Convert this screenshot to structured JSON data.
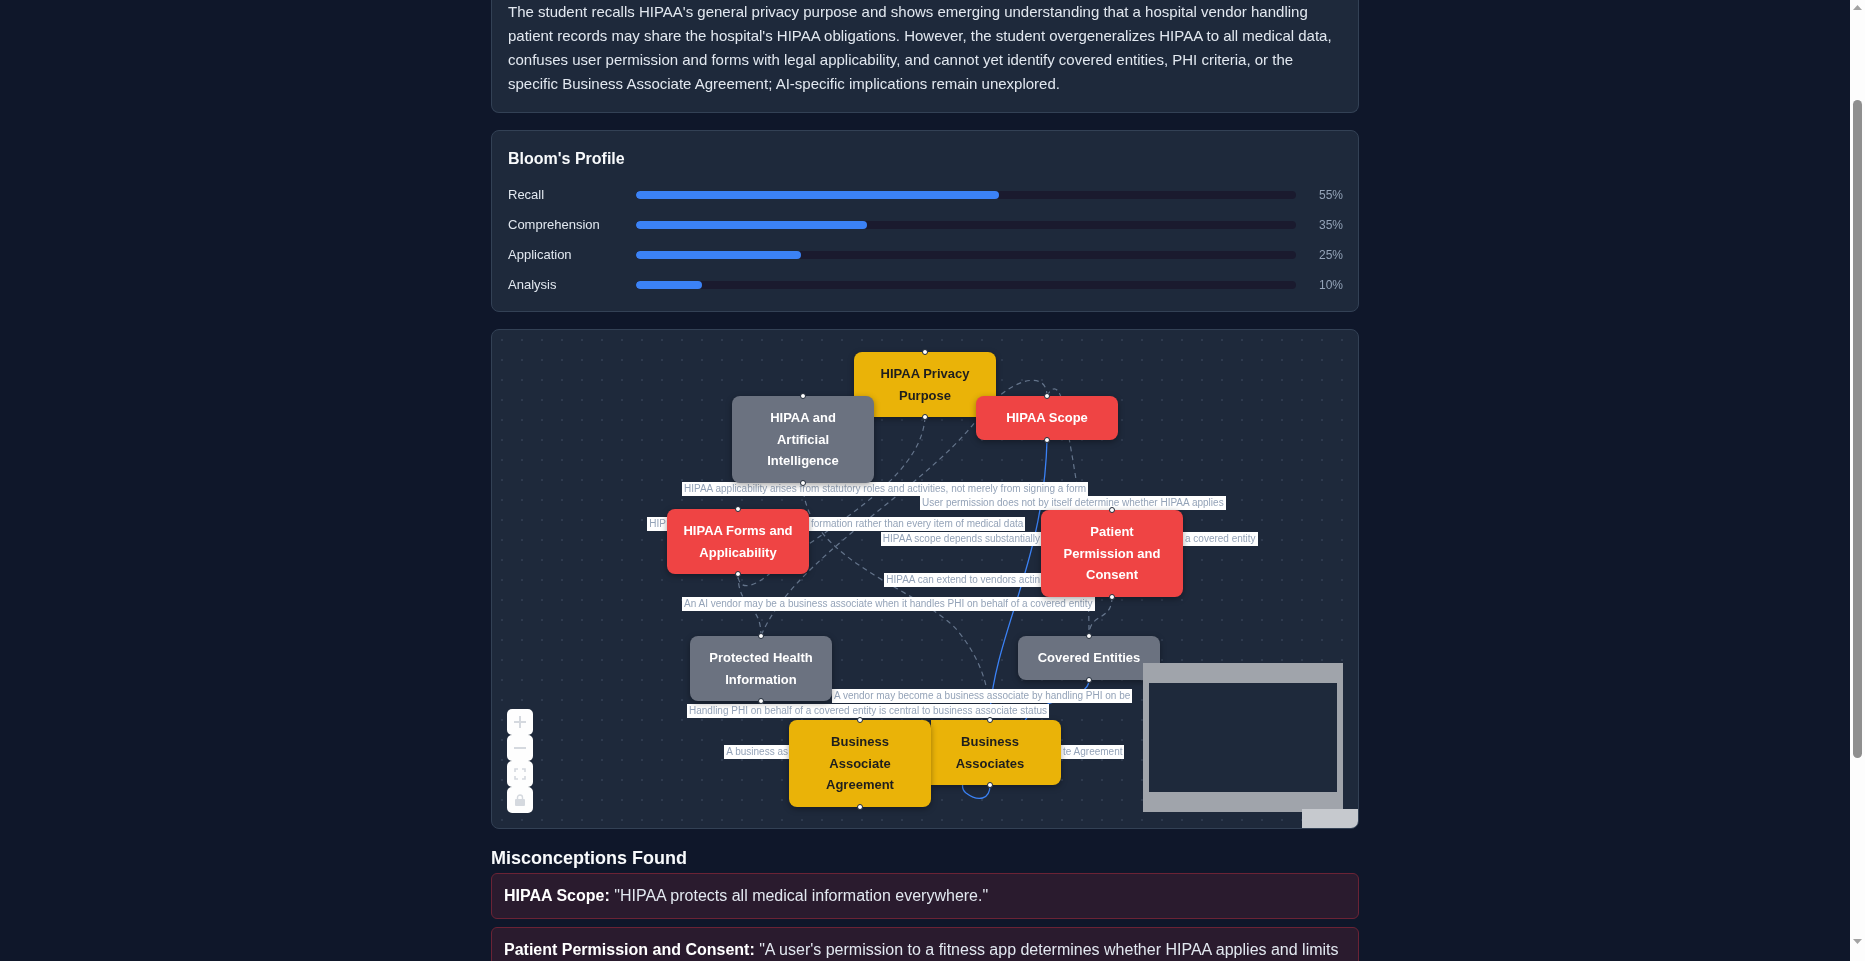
{
  "summary": {
    "text": "The student recalls HIPAA's general privacy purpose and shows emerging understanding that a hospital vendor handling patient records may share the hospital's HIPAA obligations. However, the student overgeneralizes HIPAA to all medical data, confuses user permission and forms with legal applicability, and cannot yet identify covered entities, PHI criteria, or the specific Business Associate Agreement; AI-specific implications remain unexplored."
  },
  "bloom_profile": {
    "title": "Bloom's Profile",
    "levels": [
      {
        "name": "Recall",
        "level": 0.55,
        "reading": "55%"
      },
      {
        "name": "Comprehension",
        "level": 0.35,
        "reading": "35%"
      },
      {
        "name": "Application",
        "level": 0.25,
        "reading": "25%"
      },
      {
        "name": "Analysis",
        "level": 0.1,
        "reading": "10%"
      }
    ]
  },
  "concept_map": {
    "nodes": [
      {
        "label": "HIPAA Privacy Purpose",
        "color": "#eab308"
      },
      {
        "label": "HIPAA and Artificial Intelligence",
        "color": "#6b7280"
      },
      {
        "label": "HIPAA Scope",
        "color": "#ef4444"
      },
      {
        "label": "HIPAA Forms and Applicability",
        "color": "#ef4444"
      },
      {
        "label": "Patient Permission and Consent",
        "color": "#ef4444"
      },
      {
        "label": "Protected Health Information",
        "color": "#6b7280"
      },
      {
        "label": "Covered Entities",
        "color": "#6b7280"
      },
      {
        "label": "Business Associate Agreement",
        "color": "#eab308"
      },
      {
        "label": "Business Associates",
        "color": "#eab308"
      }
    ],
    "edges": [
      {
        "kind": "dashed"
      },
      {
        "kind": "dashed"
      },
      {
        "kind": "dashed"
      },
      {
        "kind": "dashed"
      },
      {
        "kind": "dashed"
      },
      {
        "kind": "dashed"
      },
      {
        "kind": "dashed"
      },
      {
        "kind": "solid"
      },
      {
        "kind": "solid"
      }
    ],
    "edge_labels": [
      {
        "text": "HIPAA applicability arises from statutory roles and activities, not merely from signing a form"
      },
      {
        "text": "User permission does not by itself determine whether HIPAA applies"
      },
      {
        "text": "HIP"
      },
      {
        "text": "formation rather than every item of medical data"
      },
      {
        "text": "HIPAA scope depends substantially"
      },
      {
        "text": "a covered entity"
      },
      {
        "text": "HIPAA can extend to vendors actin"
      },
      {
        "text": "An AI vendor may be a business associate when it handles PHI on behalf of a covered entity"
      },
      {
        "text": "A vendor may become a business associate by handling PHI on be"
      },
      {
        "text": "Handling PHI on behalf of a covered entity is central to business associate status"
      },
      {
        "text": "A business as"
      },
      {
        "text": "te Agreement"
      }
    ]
  },
  "misconceptions": {
    "title": "Misconceptions Found",
    "items": [
      {
        "text": "**HIPAA Scope:** \"HIPAA protects all medical information everywhere.\""
      },
      {
        "text": "**Patient Permission and Consent:** \"A user's permission to a fitness app determines whether HIPAA applies and limits"
      }
    ]
  }
}
